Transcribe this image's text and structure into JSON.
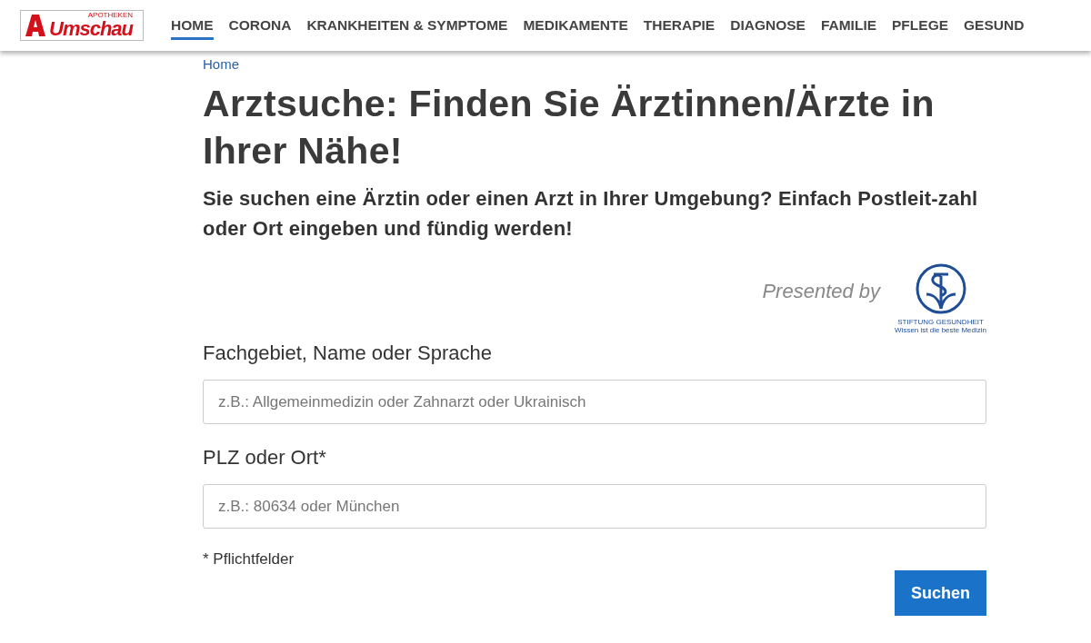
{
  "header": {
    "logo": {
      "small": "APOTHEKEN",
      "name": "Umschau"
    },
    "nav": [
      {
        "label": "HOME",
        "selected": true
      },
      {
        "label": "CORONA",
        "selected": false
      },
      {
        "label": "KRANKHEITEN & SYMPTOME",
        "selected": false
      },
      {
        "label": "MEDIKAMENTE",
        "selected": false
      },
      {
        "label": "THERAPIE",
        "selected": false
      },
      {
        "label": "DIAGNOSE",
        "selected": false
      },
      {
        "label": "FAMILIE",
        "selected": false
      },
      {
        "label": "PFLEGE",
        "selected": false
      },
      {
        "label": "GESUND",
        "selected": false
      }
    ]
  },
  "breadcrumb": "Home",
  "title": "Arztsuche: Finden Sie Ärztinnen/Ärzte in Ihrer Nähe!",
  "intro": "Sie suchen eine Ärztin oder einen Arzt in Ihrer Umgebung? Einfach Postleit-zahl oder Ort eingeben und fündig werden!",
  "sponsor": {
    "text": "Presented by",
    "logo_name": "STIFTUNG GESUNDHEIT",
    "logo_tagline": "Wissen ist die beste Medizin"
  },
  "fields": [
    {
      "label": "Fachgebiet, Name oder Sprache",
      "placeholder": "z.B.: Allgemeinmedizin oder Zahnarzt oder Ukrainisch"
    },
    {
      "label": "PLZ oder Ort*",
      "placeholder": "z.B.: 80634 oder München"
    }
  ],
  "required_note": "* Pflichtfelder",
  "submit": "Suchen"
}
